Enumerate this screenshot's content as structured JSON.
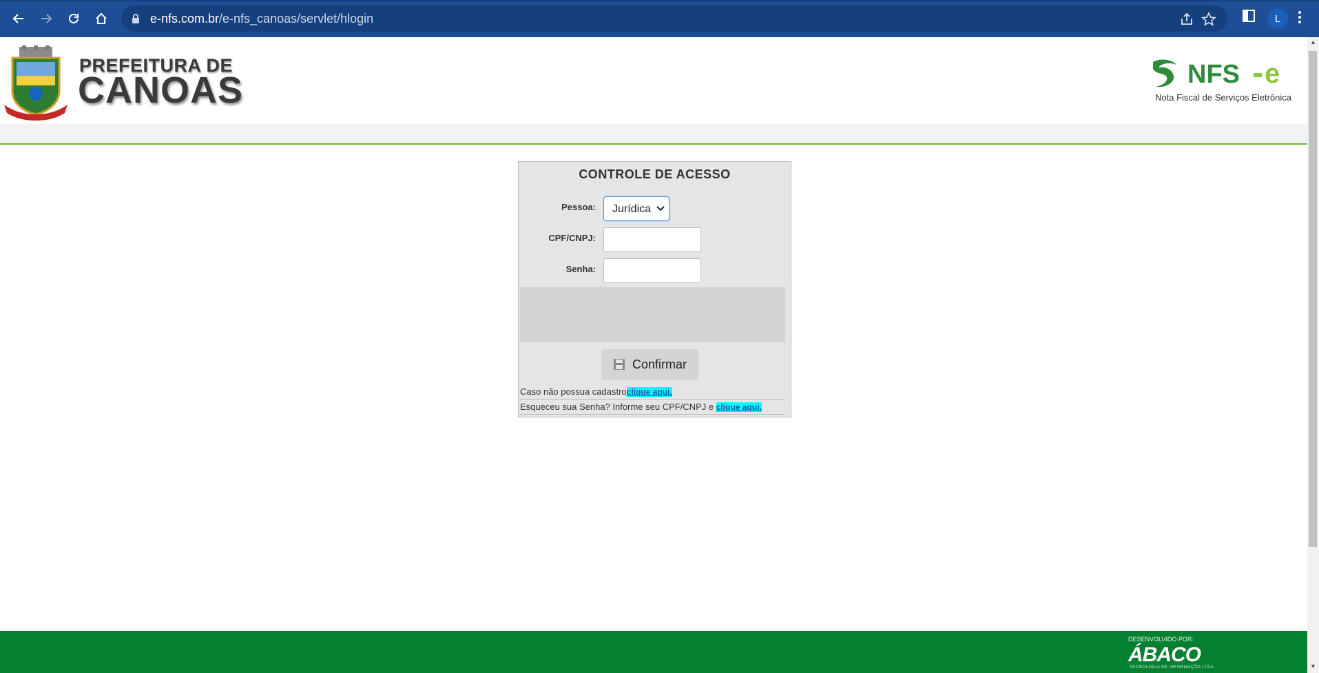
{
  "browser": {
    "url_host": "e-nfs.com.br",
    "url_path": "/e-nfs_canoas/servlet/hlogin",
    "avatar_letter": "L",
    "accent": "#1e4f96"
  },
  "header": {
    "pref_line1": "PREFEITURA DE",
    "pref_line2": "CANOAS",
    "nfse_logo": "NFS-e",
    "nfse_subtitle": "Nota Fiscal de Serviços Eletrônica"
  },
  "login": {
    "title": "CONTROLE DE ACESSO",
    "pessoa_label": "Pessoa:",
    "pessoa_value": "Jurídica",
    "cpf_label": "CPF/CNPJ:",
    "cpf_value": "",
    "senha_label": "Senha:",
    "senha_value": "",
    "confirm_label": "Confirmar",
    "register_text": "Caso não possua cadastro",
    "register_link": "clique aqui.",
    "forgot_text": "Esqueceu sua Senha? Informe seu CPF/CNPJ e ",
    "forgot_link": "clique aqui."
  },
  "footer": {
    "developed_by": "DESENVOLVIDO POR:",
    "brand": "ÁBACO",
    "brand_sub": "TECNOLOGIA DE INFORMAÇÃO LTDA.",
    "color": "#038030"
  }
}
